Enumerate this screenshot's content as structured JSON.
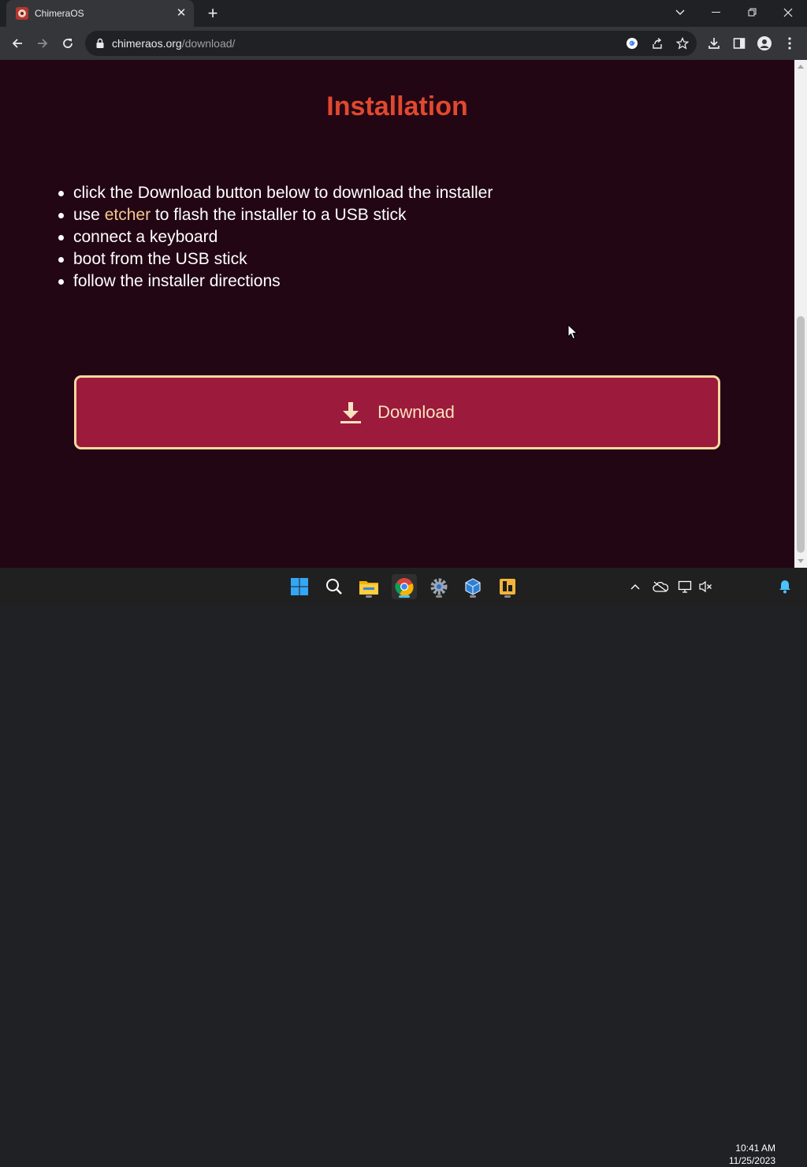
{
  "browser": {
    "tab": {
      "title": "ChimeraOS",
      "favicon": "chimeraos-logo-icon"
    },
    "url": {
      "domain": "chimeraos.org",
      "path": "/download/"
    }
  },
  "page": {
    "heading": "Installation",
    "steps": [
      {
        "text": "click the Download button below to download the installer"
      },
      {
        "before": "use ",
        "link": "etcher",
        "after": " to flash the installer to a USB stick"
      },
      {
        "text": "connect a keyboard"
      },
      {
        "text": "boot from the USB stick"
      },
      {
        "text": "follow the installer directions"
      }
    ],
    "download_button": {
      "label": "Download"
    }
  },
  "taskbar": {
    "apps": [
      "windows-start-icon",
      "search-icon",
      "file-explorer-icon",
      "chrome-icon",
      "settings-icon",
      "virtualbox-icon",
      "app-icon"
    ],
    "clock": {
      "time": "10:41 AM",
      "date": "11/25/2023"
    }
  },
  "colors": {
    "page_background": "#230614",
    "heading": "#e0492f",
    "link": "#f3c98f",
    "button_fill": "#9c1a3b",
    "button_border": "#f6d9a0"
  }
}
